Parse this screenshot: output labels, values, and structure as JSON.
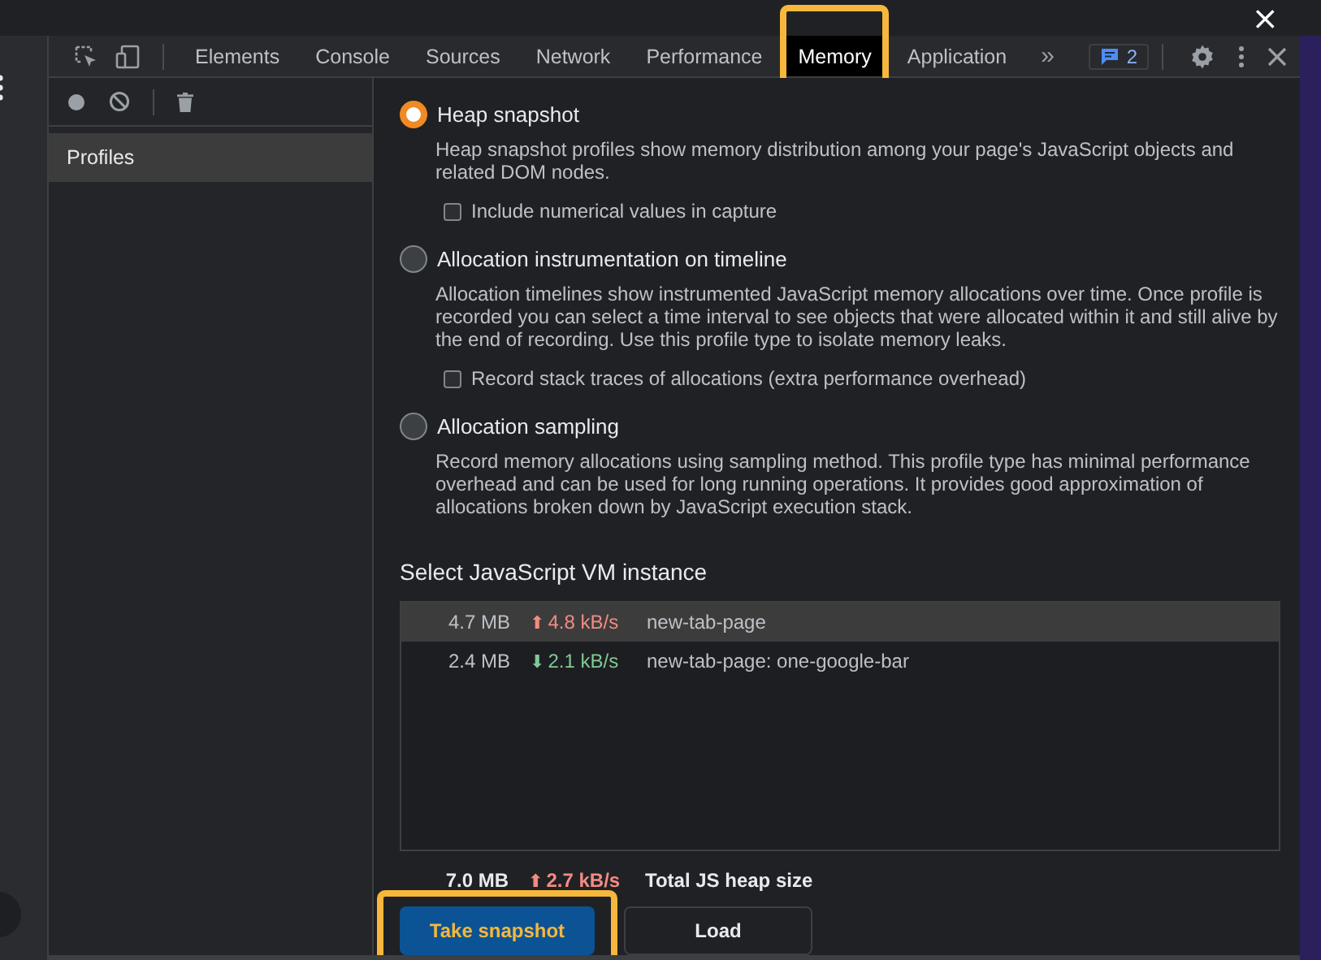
{
  "window": {
    "close": "×"
  },
  "toolbar": {
    "tabs": [
      {
        "label": "Elements",
        "selected": false,
        "highlighted": false
      },
      {
        "label": "Console",
        "selected": false,
        "highlighted": false
      },
      {
        "label": "Sources",
        "selected": false,
        "highlighted": false
      },
      {
        "label": "Network",
        "selected": false,
        "highlighted": false
      },
      {
        "label": "Performance",
        "selected": false,
        "highlighted": false
      },
      {
        "label": "Memory",
        "selected": true,
        "highlighted": true
      },
      {
        "label": "Application",
        "selected": false,
        "highlighted": false
      }
    ],
    "more": "»",
    "issues_count": "2"
  },
  "sidebar": {
    "items": [
      {
        "label": "Profiles",
        "selected": true
      }
    ]
  },
  "profile_types": [
    {
      "title": "Heap snapshot",
      "selected": true,
      "description": "Heap snapshot profiles show memory distribution among your page's JavaScript objects and related DOM nodes.",
      "option": {
        "label": "Include numerical values in capture",
        "checked": false
      }
    },
    {
      "title": "Allocation instrumentation on timeline",
      "selected": false,
      "description": "Allocation timelines show instrumented JavaScript memory allocations over time. Once profile is recorded you can select a time interval to see objects that were allocated within it and still alive by the end of recording. Use this profile type to isolate memory leaks.",
      "option": {
        "label": "Record stack traces of allocations (extra performance overhead)",
        "checked": false
      }
    },
    {
      "title": "Allocation sampling",
      "selected": false,
      "description": "Record memory allocations using sampling method. This profile type has minimal performance overhead and can be used for long running operations. It provides good approximation of allocations broken down by JavaScript execution stack."
    }
  ],
  "vm_section": {
    "title": "Select JavaScript VM instance",
    "rows": [
      {
        "size": "4.7 MB",
        "arrow": "⬆",
        "rate": "4.8 kB/s",
        "color": "#f28b82",
        "name": "new-tab-page",
        "selected": true
      },
      {
        "size": "2.4 MB",
        "arrow": "⬇",
        "rate": "2.1 kB/s",
        "color": "#81c995",
        "name": "new-tab-page: one-google-bar",
        "selected": false
      }
    ],
    "total": {
      "size": "7.0 MB",
      "arrow": "⬆",
      "rate": "2.7 kB/s",
      "color": "#f28b82",
      "label": "Total JS heap size"
    }
  },
  "buttons": [
    {
      "label": "Take snapshot",
      "kind": "primary",
      "highlighted": true
    },
    {
      "label": "Load",
      "kind": "secondary",
      "highlighted": false
    }
  ]
}
